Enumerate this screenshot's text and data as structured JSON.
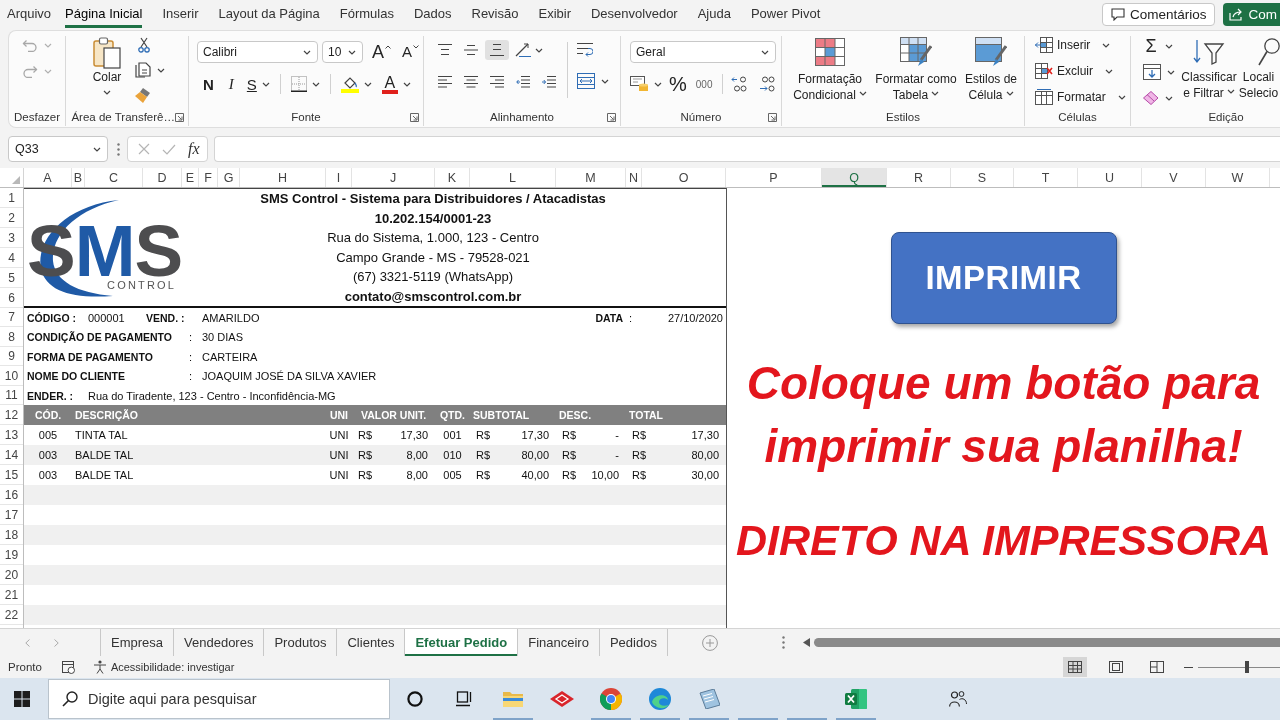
{
  "menu_tabs": [
    {
      "label": "Arquivo",
      "selected": false
    },
    {
      "label": "Página Inicial",
      "selected": true
    },
    {
      "label": "Inserir",
      "selected": false
    },
    {
      "label": "Layout da Página",
      "selected": false
    },
    {
      "label": "Fórmulas",
      "selected": false
    },
    {
      "label": "Dados",
      "selected": false
    },
    {
      "label": "Revisão",
      "selected": false
    },
    {
      "label": "Exibir",
      "selected": false
    },
    {
      "label": "Desenvolvedor",
      "selected": false
    },
    {
      "label": "Ajuda",
      "selected": false
    },
    {
      "label": "Power Pivot",
      "selected": false
    }
  ],
  "header_buttons": [
    {
      "kind": "comments",
      "label": "Comentários"
    },
    {
      "kind": "share",
      "label": "Com"
    }
  ],
  "ribbon": {
    "undo": {
      "label": "Desfazer",
      "buttons": [
        {
          "kind": "undo",
          "disabled": true
        },
        {
          "kind": "redo",
          "disabled": true
        }
      ]
    },
    "clipboard": {
      "label": "Área de Transferê…",
      "paste": "Colar"
    },
    "font": {
      "label": "Fonte",
      "font_name": "Calibri",
      "font_size": "10",
      "grow_button": "A",
      "shrink_button": "A",
      "bold_button": "N",
      "italic_button": "I",
      "underline_button": "S",
      "color_button": "A"
    },
    "alignment": {
      "label": "Alinhamento",
      "vertical_align": [
        {
          "kind": "top",
          "selected": false
        },
        {
          "kind": "middle",
          "selected": false
        },
        {
          "kind": "bottom",
          "selected": true
        }
      ],
      "horizontal_align": [
        {
          "kind": "left",
          "selected": false
        },
        {
          "kind": "center",
          "selected": false
        },
        {
          "kind": "right",
          "selected": false
        }
      ]
    },
    "number": {
      "label": "Número",
      "format": "Geral",
      "percent_button": "%",
      "thousands_button": "000"
    },
    "styles": {
      "label": "Estilos",
      "buttons": [
        {
          "kind": "conditional",
          "lines": [
            "Formatação",
            "Condicional"
          ]
        },
        {
          "kind": "table",
          "lines": [
            "Formatar como",
            "Tabela"
          ]
        },
        {
          "kind": "cell_styles",
          "lines": [
            "Estilos de",
            "Célula"
          ]
        }
      ]
    },
    "cells": {
      "label": "Células",
      "buttons": [
        {
          "kind": "insert",
          "label": "Inserir"
        },
        {
          "kind": "delete",
          "label": "Excluir"
        },
        {
          "kind": "format",
          "label": "Formatar"
        }
      ]
    },
    "editing": {
      "label": "Edição",
      "sum_button": "Σ",
      "buttons": [
        {
          "kind": "sort",
          "lines": [
            "Classificar",
            "e Filtrar"
          ]
        },
        {
          "kind": "find",
          "lines": [
            "Locali",
            "Selecio"
          ]
        }
      ]
    }
  },
  "formula_bar": {
    "name_box": "Q33",
    "function_button": "fx"
  },
  "columns": [
    {
      "label": "A",
      "selected": false
    },
    {
      "label": "B",
      "selected": false
    },
    {
      "label": "C",
      "selected": false
    },
    {
      "label": "D",
      "selected": false
    },
    {
      "label": "E",
      "selected": false
    },
    {
      "label": "F",
      "selected": false
    },
    {
      "label": "G",
      "selected": false
    },
    {
      "label": "H",
      "selected": false
    },
    {
      "label": "I",
      "selected": false
    },
    {
      "label": "J",
      "selected": false
    },
    {
      "label": "K",
      "selected": false
    },
    {
      "label": "L",
      "selected": false
    },
    {
      "label": "M",
      "selected": false
    },
    {
      "label": "N",
      "selected": false
    },
    {
      "label": "O",
      "selected": false
    },
    {
      "label": "P",
      "selected": false
    },
    {
      "label": "Q",
      "selected": true
    },
    {
      "label": "R",
      "selected": false
    },
    {
      "label": "S",
      "selected": false
    },
    {
      "label": "T",
      "selected": false
    },
    {
      "label": "U",
      "selected": false
    },
    {
      "label": "V",
      "selected": false
    },
    {
      "label": "W",
      "selected": false
    }
  ],
  "row_numbers": [
    "1",
    "2",
    "3",
    "4",
    "5",
    "6",
    "7",
    "8",
    "9",
    "10",
    "11",
    "12",
    "13",
    "14",
    "15",
    "16",
    "17",
    "18",
    "19",
    "20",
    "21",
    "22"
  ],
  "document": {
    "logo": {
      "letters": [
        "S",
        "M",
        "S"
      ],
      "tagline": "CONTROL"
    },
    "company_lines": [
      {
        "text": "SMS Control - Sistema para Distribuidores / Atacadistas",
        "bold": true
      },
      {
        "text": "10.202.154/0001-23",
        "bold": true
      },
      {
        "text": "Rua do Sistema, 1.000, 123 - Centro",
        "bold": false
      },
      {
        "text": "Campo Grande - MS - 79528-021",
        "bold": false
      },
      {
        "text": "(67) 3321-5119 (WhatsApp)",
        "bold": false
      },
      {
        "text": "contato@smscontrol.com.br",
        "bold": true
      }
    ],
    "info_rows": [
      {
        "cells": [
          {
            "text": "CÓDIGO :",
            "bold": true
          },
          {
            "text": "000001",
            "bold": false
          },
          {
            "text": "VEND. :",
            "bold": true
          },
          {
            "text": "AMARILDO",
            "bold": false
          },
          {
            "text": "DATA",
            "bold": true
          },
          {
            "text": ":",
            "bold": false
          },
          {
            "text": "27/10/2020",
            "bold": false
          }
        ]
      },
      {
        "cells": [
          {
            "text": "CONDIÇÃO DE PAGAMENTO",
            "bold": true
          },
          {
            "text": ":",
            "bold": false
          },
          {
            "text": "30 DIAS",
            "bold": false
          }
        ]
      },
      {
        "cells": [
          {
            "text": "FORMA DE PAGAMENTO",
            "bold": true
          },
          {
            "text": ":",
            "bold": false
          },
          {
            "text": "CARTEIRA",
            "bold": false
          }
        ]
      },
      {
        "cells": [
          {
            "text": "NOME DO CLIENTE",
            "bold": true
          },
          {
            "text": ":",
            "bold": false
          },
          {
            "text": "JOAQUIM JOSÉ DA SILVA XAVIER",
            "bold": false
          }
        ]
      },
      {
        "cells": [
          {
            "text": "ENDER.  :",
            "bold": true
          },
          {
            "text": "Rua do Tiradente, 123 - Centro - Inconfidência-MG",
            "bold": false
          }
        ]
      }
    ],
    "items_table": {
      "columns": [
        "CÓD.",
        "DESCRIÇÃO",
        "UNI",
        "VALOR UNIT.",
        "QTD.",
        "SUBTOTAL",
        "DESC.",
        "TOTAL"
      ],
      "rows": [
        {
          "code": "005",
          "description": "TINTA TAL",
          "unit": "UNI",
          "unit_price": {
            "currency": "R$",
            "amount": "17,30"
          },
          "quantity": "001",
          "subtotal": {
            "currency": "R$",
            "amount": "17,30"
          },
          "discount": {
            "currency": "R$",
            "amount": "-"
          },
          "total": {
            "currency": "R$",
            "amount": "17,30"
          }
        },
        {
          "code": "003",
          "description": "BALDE TAL",
          "unit": "UNI",
          "unit_price": {
            "currency": "R$",
            "amount": "8,00"
          },
          "quantity": "010",
          "subtotal": {
            "currency": "R$",
            "amount": "80,00"
          },
          "discount": {
            "currency": "R$",
            "amount": "-"
          },
          "total": {
            "currency": "R$",
            "amount": "80,00"
          }
        },
        {
          "code": "003",
          "description": "BALDE TAL",
          "unit": "UNI",
          "unit_price": {
            "currency": "R$",
            "amount": "8,00"
          },
          "quantity": "005",
          "subtotal": {
            "currency": "R$",
            "amount": "40,00"
          },
          "discount": {
            "currency": "R$",
            "amount": "10,00"
          },
          "total": {
            "currency": "R$",
            "amount": "30,00"
          }
        }
      ]
    }
  },
  "print_button": {
    "label": "IMPRIMIR"
  },
  "callouts": [
    "Coloque um botão para imprimir sua planilha!",
    "DIRETO NA IMPRESSORA"
  ],
  "sheet_tabs": [
    {
      "label": "Empresa",
      "selected": false
    },
    {
      "label": "Vendedores",
      "selected": false
    },
    {
      "label": "Produtos",
      "selected": false
    },
    {
      "label": "Clientes",
      "selected": false
    },
    {
      "label": "Efetuar Pedido",
      "selected": true
    },
    {
      "label": "Financeiro",
      "selected": false
    },
    {
      "label": "Pedidos",
      "selected": false
    }
  ],
  "status_bar": {
    "status": "Pronto",
    "accessibility": "Acessibilidade: investigar",
    "views": [
      {
        "kind": "normal",
        "selected": true
      },
      {
        "kind": "page_layout",
        "selected": false
      },
      {
        "kind": "page_break",
        "selected": false
      }
    ],
    "zoom": {
      "level": 0.6
    }
  },
  "taskbar": {
    "search": {
      "placeholder": "Digite aqui para pesquisar"
    },
    "apps": [
      {
        "kind": "explorer",
        "running": true
      },
      {
        "kind": "diamond",
        "running": false
      },
      {
        "kind": "chrome",
        "running": true
      },
      {
        "kind": "edge",
        "running": true
      },
      {
        "kind": "notes",
        "running": true
      },
      {
        "kind": "blank",
        "running": true
      },
      {
        "kind": "blank",
        "running": true
      },
      {
        "kind": "excel",
        "running": true
      }
    ]
  }
}
